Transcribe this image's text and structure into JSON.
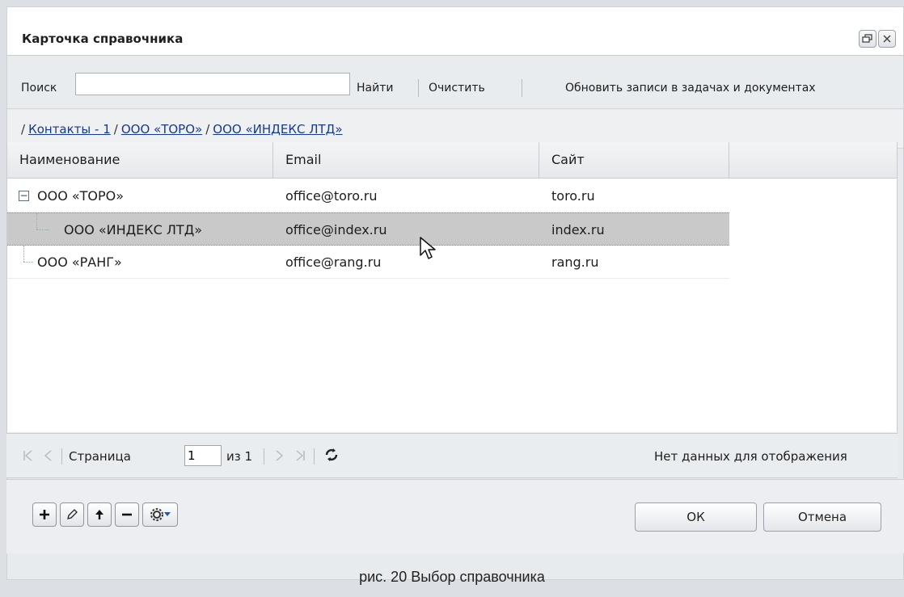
{
  "window": {
    "title": "Карточка справочника",
    "restore_icon": "restore-window-icon",
    "close_icon": "close-icon"
  },
  "search": {
    "label": "Поиск",
    "value": "",
    "placeholder": "",
    "find_label": "Найти",
    "clear_label": "Очистить",
    "update_label": "Обновить записи в задачах и документах"
  },
  "breadcrumb": {
    "items": [
      "Контакты - 1",
      "ООО «ТОРО»",
      "ООО «ИНДЕКС ЛТД»"
    ],
    "separator": "/"
  },
  "grid": {
    "columns": [
      "Наименование",
      "Email",
      "Сайт"
    ],
    "rows": [
      {
        "name": "ООО «ТОРО»",
        "email": "office@toro.ru",
        "site": "toro.ru",
        "expanded": true,
        "level": 0
      },
      {
        "name": "ООО «ИНДЕКС ЛТД»",
        "email": "office@index.ru",
        "site": "index.ru",
        "selected": true,
        "level": 1
      },
      {
        "name": "ООО «РАНГ»",
        "email": "office@rang.ru",
        "site": "rang.ru",
        "level": 0
      }
    ]
  },
  "pager": {
    "page_label": "Страница",
    "page_value": "1",
    "of_label": "из 1",
    "status": "Нет данных для отображения"
  },
  "footer": {
    "ok_label": "ОК",
    "cancel_label": "Отмена"
  },
  "caption": "рис. 20 Выбор справочника",
  "colors": {
    "link": "#173b8a",
    "selected_row": "#c9c9c9"
  }
}
